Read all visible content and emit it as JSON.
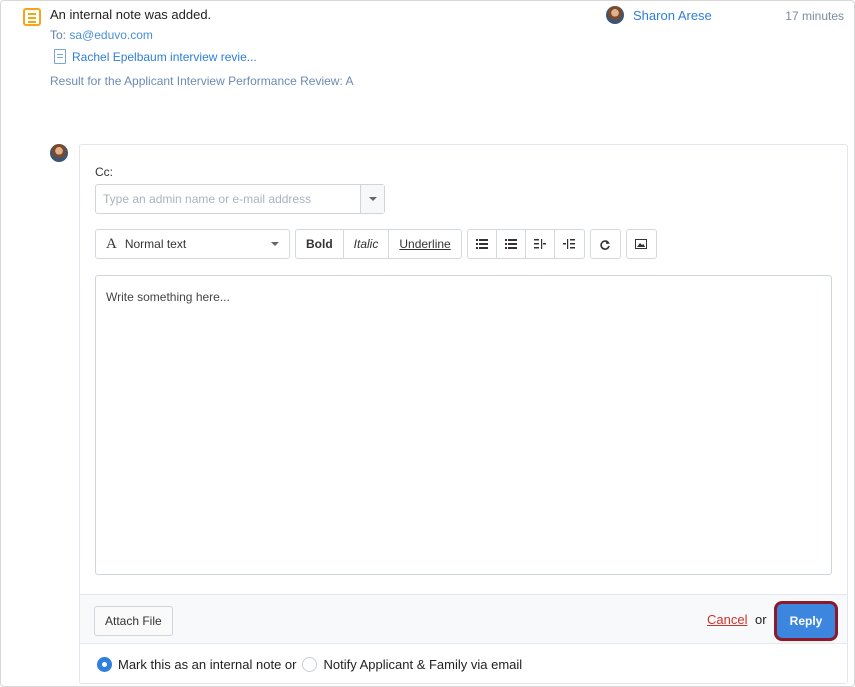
{
  "note": {
    "title": "An internal note was added.",
    "to_label": "To:",
    "to_value": "sa@eduvo.com",
    "attachment": "Rachel Epelbaum interview revie...",
    "result": "Result for the Applicant Interview Performance Review:  A",
    "author": "Sharon Arese",
    "timestamp": "17 minutes"
  },
  "reply": {
    "cc_label": "Cc:",
    "cc_placeholder": "Type an admin name or e-mail address",
    "style_symbol": "A",
    "style_value": "Normal text",
    "bold_label": "Bold",
    "italic_label": "Italic",
    "underline_label": "Underline",
    "editor_placeholder": "Write something here...",
    "attach_label": "Attach File",
    "cancel_label": "Cancel",
    "or_label": "or",
    "reply_label": "Reply",
    "internal_note_label": "Mark this as an internal note or",
    "notify_label": "Notify Applicant & Family via email",
    "internal_note_selected": true
  },
  "icons": {
    "note": "note-icon",
    "doc": "document-icon",
    "avatar": "user-avatar",
    "list_bullet": "bulleted-list-icon",
    "list_number": "numbered-list-icon",
    "outdent": "outdent-icon",
    "indent": "indent-icon",
    "redo": "redo-icon",
    "image": "image-icon"
  },
  "colors": {
    "accent": "#2f7fe0",
    "note_icon": "#f3a712",
    "cancel": "#d0332c",
    "reply_outline": "#8b1a2b"
  }
}
